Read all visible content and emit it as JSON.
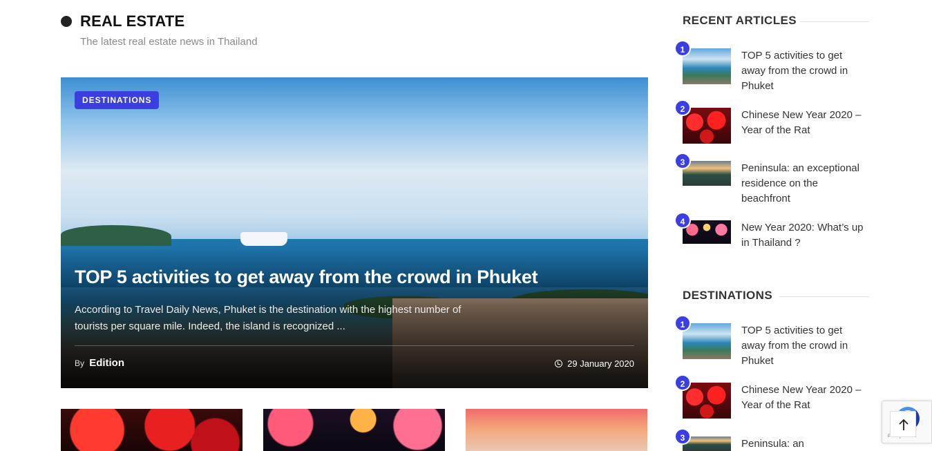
{
  "section": {
    "title": "REAL ESTATE",
    "subtitle": "The latest real estate news in Thailand"
  },
  "featured": {
    "category": "DESTINATIONS",
    "title": "TOP 5 activities to get away from the crowd in Phuket",
    "excerpt": "According to Travel Daily News, Phuket is the destination with the highest number of tourists per square mile. Indeed, the island is recognized ...",
    "by_label": "By",
    "author": "Edition",
    "date": "29 January 2020"
  },
  "sidebar": {
    "recent": {
      "title": "RECENT ARTICLES",
      "items": [
        {
          "num": "1",
          "title": "TOP 5 activities to get away from the crowd in Phuket"
        },
        {
          "num": "2",
          "title": "Chinese New Year 2020 – Year of the Rat"
        },
        {
          "num": "3",
          "title": "Peninsula: an exceptional residence on the beachfront"
        },
        {
          "num": "4",
          "title": "New Year 2020: What’s up in Thailand ?"
        }
      ]
    },
    "destinations": {
      "title": "DESTINATIONS",
      "items": [
        {
          "num": "1",
          "title": "TOP 5 activities to get away from the crowd in Phuket"
        },
        {
          "num": "2",
          "title": "Chinese New Year 2020 – Year of the Rat"
        },
        {
          "num": "3",
          "title": "Peninsula: an"
        }
      ]
    }
  },
  "recaptcha": {
    "legal": "Privacy - Terms"
  },
  "colors": {
    "accent": "#3b3fe0",
    "heading": "#111111",
    "muted": "#8a8a8a"
  },
  "icons": {
    "bullet": "dot-icon",
    "date": "clock-icon",
    "scroll_top": "arrow-up-icon"
  }
}
